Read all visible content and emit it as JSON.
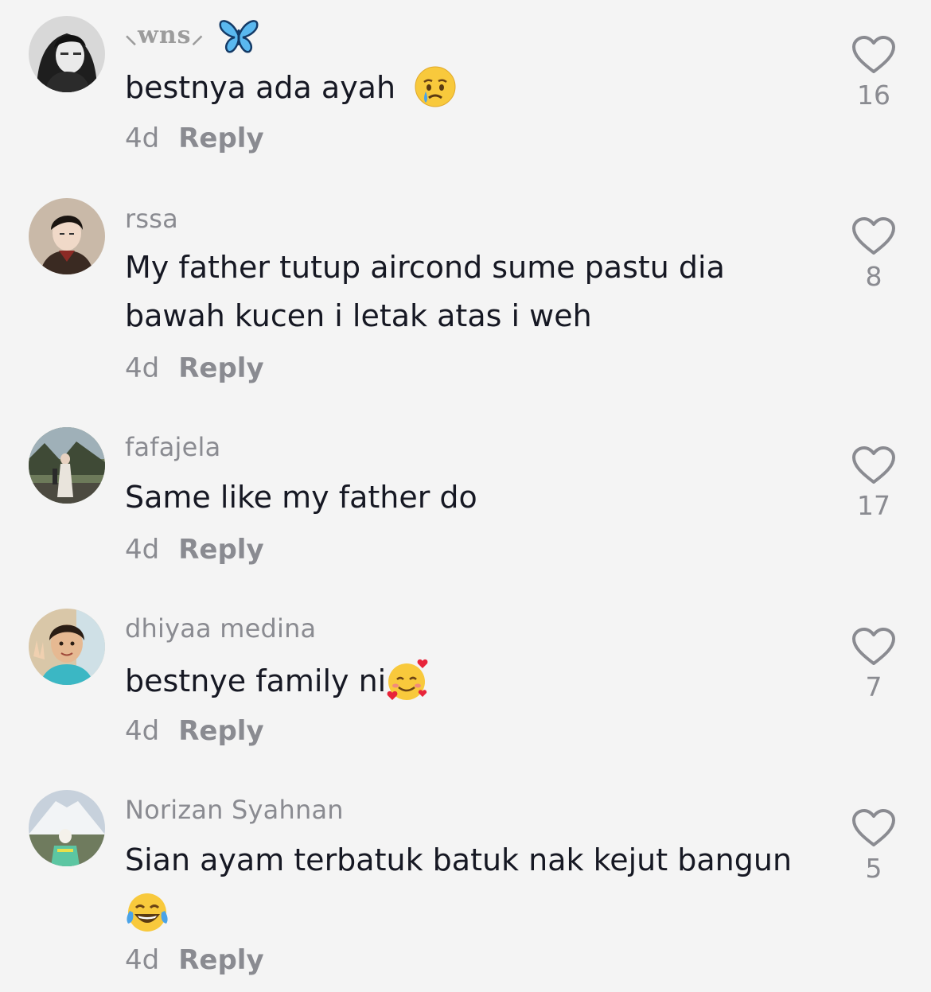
{
  "comments": [
    {
      "username": "wns",
      "username_decoration": "butterfly-icon",
      "text": "bestnya ada ayah",
      "emoji": "crying-face-emoji",
      "time": "4d",
      "reply_label": "Reply",
      "likes": "16"
    },
    {
      "username": "rssa",
      "text_line1": "My father tutup aircond sume pastu dia",
      "text_line2": "bawah kucen i letak atas i weh",
      "time": "4d",
      "reply_label": "Reply",
      "likes": "8"
    },
    {
      "username": "fafajela",
      "text": "Same like my father do",
      "time": "4d",
      "reply_label": "Reply",
      "likes": "17"
    },
    {
      "username": "dhiyaa medina",
      "text": "bestnye family ni",
      "emoji": "smiling-face-with-hearts-emoji",
      "time": "4d",
      "reply_label": "Reply",
      "likes": "7"
    },
    {
      "username": "Norizan Syahnan",
      "text": "Sian ayam terbatuk batuk nak kejut bangun",
      "emoji": "tears-of-joy-emoji",
      "time": "4d",
      "reply_label": "Reply",
      "likes": "5"
    }
  ],
  "colors": {
    "background": "#f4f4f4",
    "text": "#161823",
    "muted": "#8a8b91"
  }
}
